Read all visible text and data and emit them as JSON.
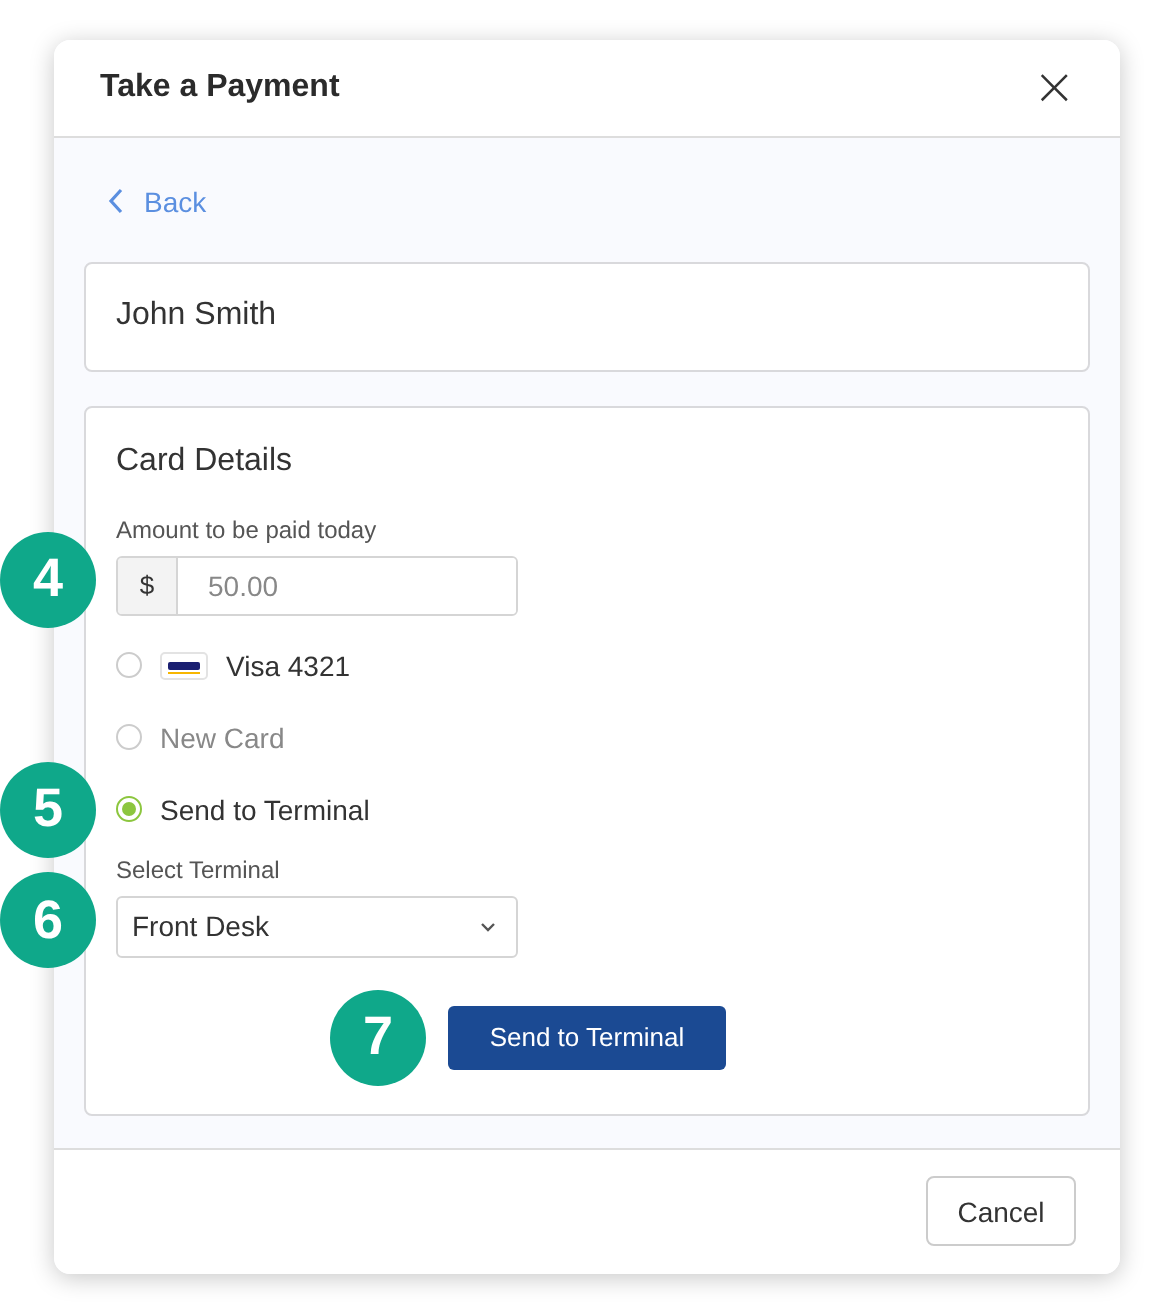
{
  "dialog": {
    "title": "Take a Payment",
    "close": "×"
  },
  "back": {
    "label": "Back"
  },
  "customer": {
    "name": "John Smith"
  },
  "card_details": {
    "title": "Card Details",
    "amount": {
      "label": "Amount to be paid today",
      "prefix": "$",
      "value": "50.00",
      "callout": "4"
    },
    "options": [
      {
        "label": "Visa 4321",
        "kind": "visa",
        "selected": false,
        "disabled": false
      },
      {
        "label": "New Card",
        "kind": "plain",
        "selected": false,
        "disabled": true
      },
      {
        "label": "Send to Terminal",
        "kind": "plain",
        "selected": true,
        "disabled": false,
        "callout": "5"
      }
    ],
    "terminal": {
      "label": "Select Terminal",
      "value": "Front Desk",
      "callout": "6"
    },
    "submit": {
      "label": "Send to Terminal",
      "callout": "7"
    }
  },
  "footer": {
    "cancel": "Cancel"
  }
}
